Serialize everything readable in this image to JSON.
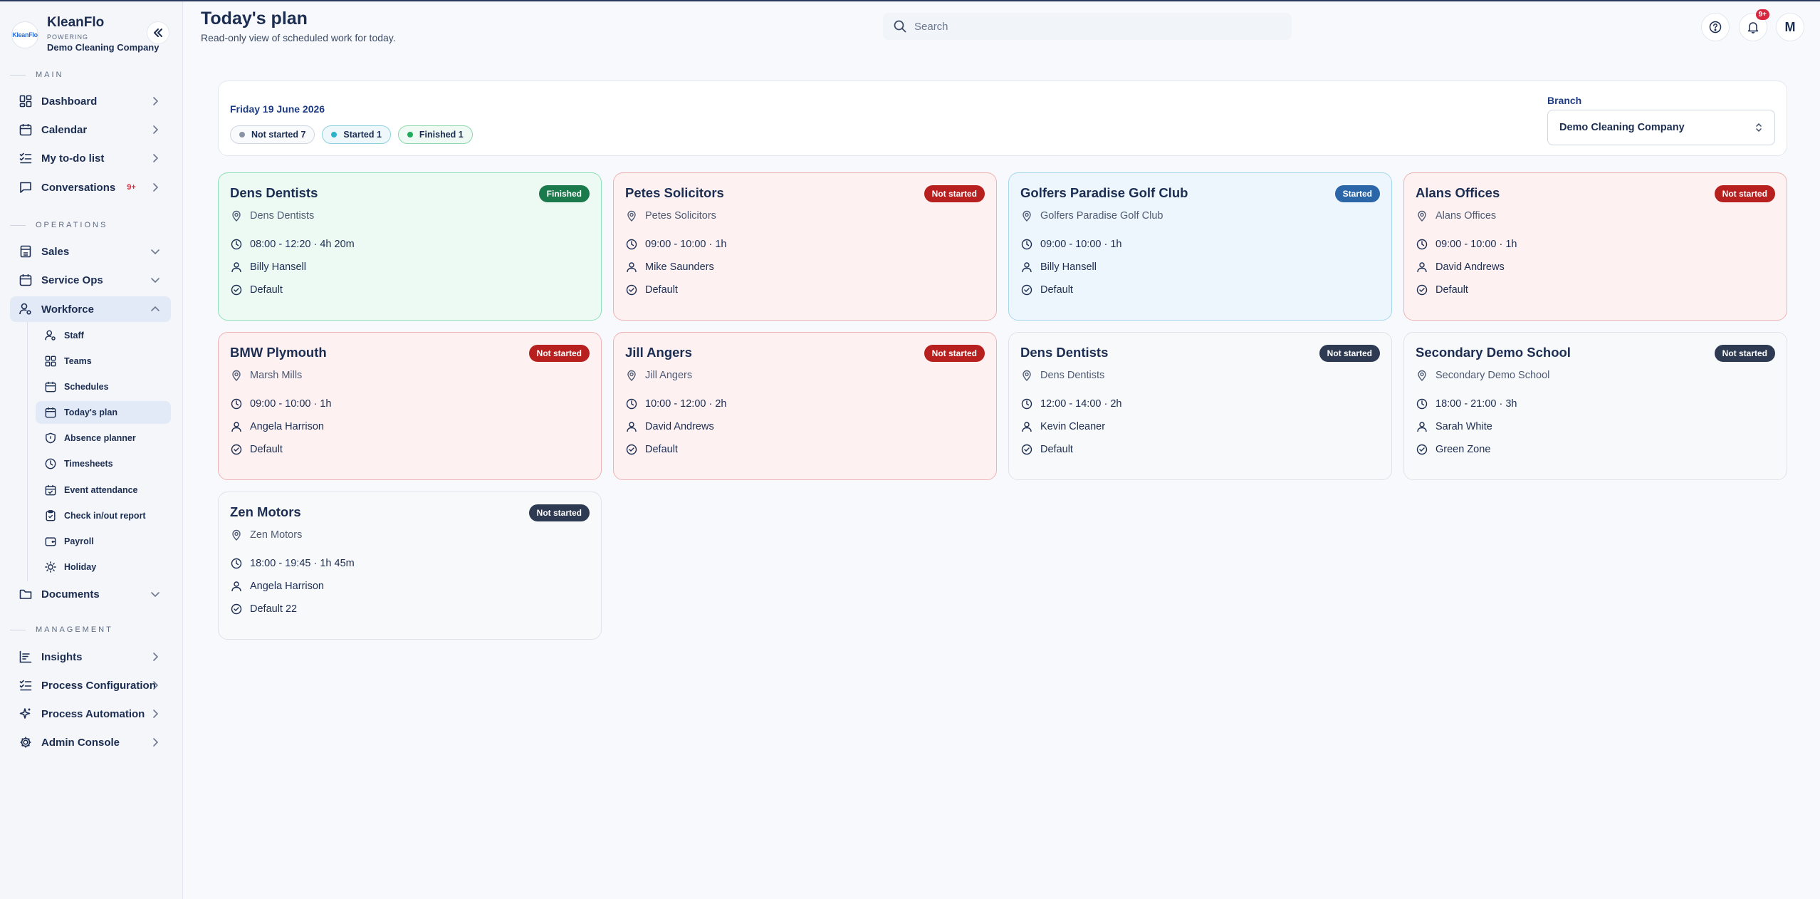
{
  "brand": {
    "name": "KleanFlo",
    "powering": "POWERING",
    "company": "Demo Cleaning Company",
    "logo_text": "KleanFlo"
  },
  "sidebar": {
    "sections": {
      "main": "MAIN",
      "operations": "OPERATIONS",
      "management": "MANAGEMENT"
    },
    "main_items": [
      {
        "label": "Dashboard",
        "icon": "dashboard-icon"
      },
      {
        "label": "Calendar",
        "icon": "calendar-icon"
      },
      {
        "label": "My to-do list",
        "icon": "checklist-icon"
      },
      {
        "label": "Conversations",
        "icon": "chat-icon",
        "badge": "9+"
      }
    ],
    "operations_items": [
      {
        "label": "Sales",
        "icon": "store-icon"
      },
      {
        "label": "Service Ops",
        "icon": "calendar-icon"
      },
      {
        "label": "Workforce",
        "icon": "user-gear-icon"
      }
    ],
    "workforce_subitems": [
      {
        "label": "Staff",
        "icon": "user-gear-icon"
      },
      {
        "label": "Teams",
        "icon": "grid-icon"
      },
      {
        "label": "Schedules",
        "icon": "calendar-icon"
      },
      {
        "label": "Today's plan",
        "icon": "calendar-icon"
      },
      {
        "label": "Absence planner",
        "icon": "shield-icon"
      },
      {
        "label": "Timesheets",
        "icon": "clock-icon"
      },
      {
        "label": "Event attendance",
        "icon": "calendar-check-icon"
      },
      {
        "label": "Check in/out report",
        "icon": "clipboard-icon"
      },
      {
        "label": "Payroll",
        "icon": "wallet-icon"
      },
      {
        "label": "Holiday",
        "icon": "sun-icon"
      }
    ],
    "documents": {
      "label": "Documents",
      "icon": "folder-icon"
    },
    "management_items": [
      {
        "label": "Insights",
        "icon": "chart-icon"
      },
      {
        "label": "Process Configuration",
        "icon": "checklist-icon"
      },
      {
        "label": "Process Automation",
        "icon": "sparkle-icon"
      },
      {
        "label": "Admin Console",
        "icon": "gear-icon"
      }
    ]
  },
  "header": {
    "title": "Today's plan",
    "subtitle": "Read-only view of scheduled work for today.",
    "search_placeholder": "Search",
    "notification_badge": "9+",
    "avatar_initial": "M"
  },
  "filters": {
    "date": "Friday 19 June 2026",
    "pills": [
      {
        "label": "Not started 7",
        "dot_color": "#8a93a6"
      },
      {
        "label": "Started 1",
        "dot_color": "#2bb3c9"
      },
      {
        "label": "Finished 1",
        "dot_color": "#1faa5c"
      }
    ],
    "branch_label": "Branch",
    "branch_value": "Demo Cleaning Company"
  },
  "jobs": [
    {
      "title": "Dens Dentists",
      "status": "Finished",
      "location": "Dens Dentists",
      "time": "08:00 - 12:20 · 4h 20m",
      "staff": "Billy Hansell",
      "team": "Default"
    },
    {
      "title": "Petes Solicitors",
      "status": "Not started",
      "location": "Petes Solicitors",
      "time": "09:00 - 10:00 · 1h",
      "staff": "Mike Saunders",
      "team": "Default"
    },
    {
      "title": "Golfers Paradise Golf Club",
      "status": "Started",
      "location": "Golfers Paradise Golf Club",
      "time": "09:00 - 10:00 · 1h",
      "staff": "Billy Hansell",
      "team": "Default"
    },
    {
      "title": "Alans Offices",
      "status": "Not started",
      "location": "Alans Offices",
      "time": "09:00 - 10:00 · 1h",
      "staff": "David Andrews",
      "team": "Default"
    },
    {
      "title": "BMW Plymouth",
      "status": "Not started",
      "location": "Marsh Mills",
      "time": "09:00 - 10:00 · 1h",
      "staff": "Angela Harrison",
      "team": "Default"
    },
    {
      "title": "Jill Angers",
      "status": "Not started",
      "location": "Jill Angers",
      "time": "10:00 - 12:00 · 2h",
      "staff": "David Andrews",
      "team": "Default"
    },
    {
      "title": "Dens Dentists",
      "status": "Not started",
      "location": "Dens Dentists",
      "time": "12:00 - 14:00 · 2h",
      "staff": "Kevin Cleaner",
      "team": "Default"
    },
    {
      "title": "Secondary Demo School",
      "status": "Not started",
      "location": "Secondary Demo School",
      "time": "18:00 - 21:00 · 3h",
      "staff": "Sarah White",
      "team": "Green Zone"
    },
    {
      "title": "Zen Motors",
      "status": "Not started",
      "location": "Zen Motors",
      "time": "18:00 - 19:45 · 1h 45m",
      "staff": "Angela Harrison",
      "team": "Default 22"
    }
  ],
  "colors": {
    "finished": "#1b7a4c",
    "started": "#2a66a8",
    "not_started_red": "#b81f1f",
    "not_started_dark": "#2e3a52",
    "brand_navy": "#1c2d52"
  }
}
